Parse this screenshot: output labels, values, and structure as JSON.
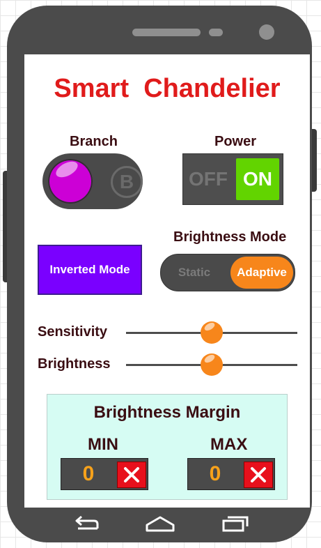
{
  "app": {
    "title": "Smart  Chandelier"
  },
  "branch": {
    "label": "Branch",
    "option_b": "B"
  },
  "power": {
    "label": "Power",
    "off_label": "OFF",
    "on_label": "ON",
    "state": "on"
  },
  "inverted_mode": {
    "label": "Inverted Mode"
  },
  "brightness_mode": {
    "label": "Brightness Mode",
    "options": [
      "Static",
      "Adaptive"
    ],
    "selected": "Adaptive"
  },
  "sliders": {
    "sensitivity": {
      "label": "Sensitivity",
      "value_fraction": 0.5
    },
    "brightness": {
      "label": "Brightness",
      "value_fraction": 0.5
    }
  },
  "margin": {
    "title": "Brightness Margin",
    "min": {
      "label": "MIN",
      "value": "0"
    },
    "max": {
      "label": "MAX",
      "value": "0"
    }
  },
  "nav": {
    "icons": [
      "back-icon",
      "home-icon",
      "recent-apps-icon"
    ]
  },
  "colors": {
    "title": "#e01b1b",
    "accent_orange": "#f7861b",
    "on_green": "#62d400",
    "inverted_purple": "#7a00ff",
    "branch_magenta": "#cc00d6",
    "panel_bg": "#d6fcf3",
    "clear_red": "#e8101c"
  }
}
